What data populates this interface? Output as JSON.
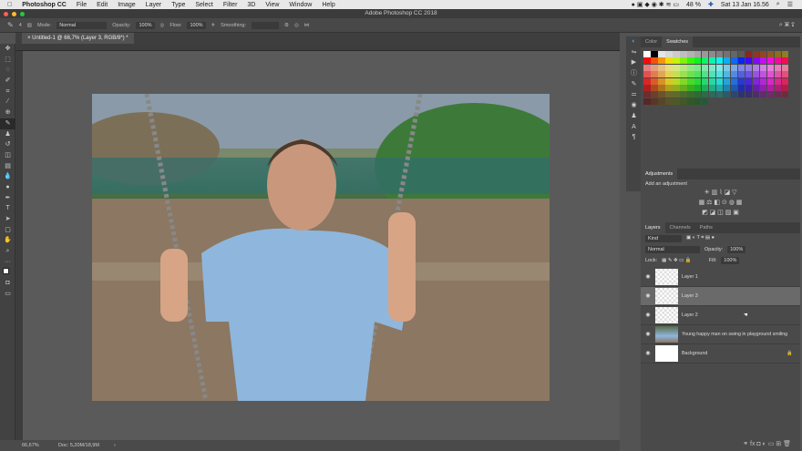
{
  "menubar": {
    "apple": "",
    "app": "Photoshop CC",
    "items": [
      "File",
      "Edit",
      "Image",
      "Layer",
      "Type",
      "Select",
      "Filter",
      "3D",
      "View",
      "Window",
      "Help"
    ],
    "battery": "48 %",
    "datetime": "Sat 13 Jan  16.56"
  },
  "window": {
    "title": "Adobe Photoshop CC 2018"
  },
  "options": {
    "brush_size": "4",
    "mode_label": "Mode:",
    "mode": "Normal",
    "opacity_label": "Opacity:",
    "opacity": "100%",
    "flow_label": "Flow:",
    "flow": "100%",
    "smoothing_label": "Smoothing:"
  },
  "document": {
    "tab": "Untitled-1 @ 66,7% (Layer 3, RGB/8*) *"
  },
  "status": {
    "zoom": "66,67%",
    "doc": "Doc: 5,20M/18,9M"
  },
  "panels": {
    "color_tabs": [
      "Color",
      "Swatches"
    ],
    "active_color_tab": "Swatches",
    "adjustments": {
      "title": "Adjustments",
      "subtitle": "Add an adjustment"
    },
    "layers_tabs": [
      "Layers",
      "Channels",
      "Paths"
    ],
    "filter_kind": "Kind",
    "blend": "Normal",
    "opacity_label": "Opacity:",
    "opacity": "100%",
    "lock_label": "Lock:",
    "fill_label": "Fill:",
    "fill": "100%",
    "layers": [
      {
        "name": "Layer 1",
        "selected": false,
        "thumb": "transparent"
      },
      {
        "name": "Layer 3",
        "selected": true,
        "thumb": "transparent"
      },
      {
        "name": "Layer 2",
        "selected": false,
        "thumb": "transparent"
      },
      {
        "name": "Young happy man on swing in playground smiling",
        "selected": false,
        "thumb": "photo"
      },
      {
        "name": "Background",
        "selected": false,
        "thumb": "white",
        "locked": true
      }
    ]
  },
  "colors": {
    "accent": "#31a8ff",
    "selected_layer": "#6a6a6a"
  }
}
